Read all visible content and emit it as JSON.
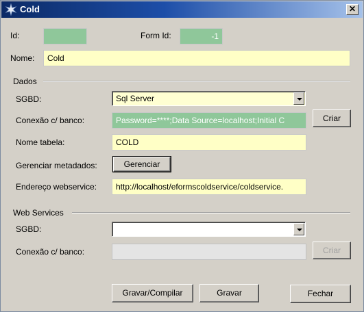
{
  "window": {
    "title": "Cold",
    "close": "✕"
  },
  "fields": {
    "id_label": "Id:",
    "id_value": "",
    "form_id_label": "Form Id:",
    "form_id_value": "-1",
    "nome_label": "Nome:",
    "nome_value": "Cold"
  },
  "dados": {
    "group_title": "Dados",
    "sgbd_label": "SGBD:",
    "sgbd_value": "Sql Server",
    "conexao_label": "Conexão c/ banco:",
    "conexao_value": "Password=****;Data  Source=localhost;Initial C",
    "criar_button": "Criar",
    "nome_tabela_label": "Nome tabela:",
    "nome_tabela_value": "COLD",
    "gerenciar_label": "Gerenciar metadados:",
    "gerenciar_button": "Gerenciar",
    "endereco_label": "Endereço webservice:",
    "endereco_value": "http://localhost/eformscoldservice/coldservice."
  },
  "web_services": {
    "group_title": "Web Services",
    "sgbd_label": "SGBD:",
    "sgbd_value": "",
    "conexao_label": "Conexão c/ banco:",
    "conexao_value": "",
    "criar_button": "Criar"
  },
  "footer": {
    "gravar_compilar": "Gravar/Compilar",
    "gravar": "Gravar",
    "fechar": "Fechar"
  },
  "colors": {
    "yellow_field": "#ffffc6",
    "green_field": "#8fc79a",
    "title_blue": "#0b2a66"
  }
}
